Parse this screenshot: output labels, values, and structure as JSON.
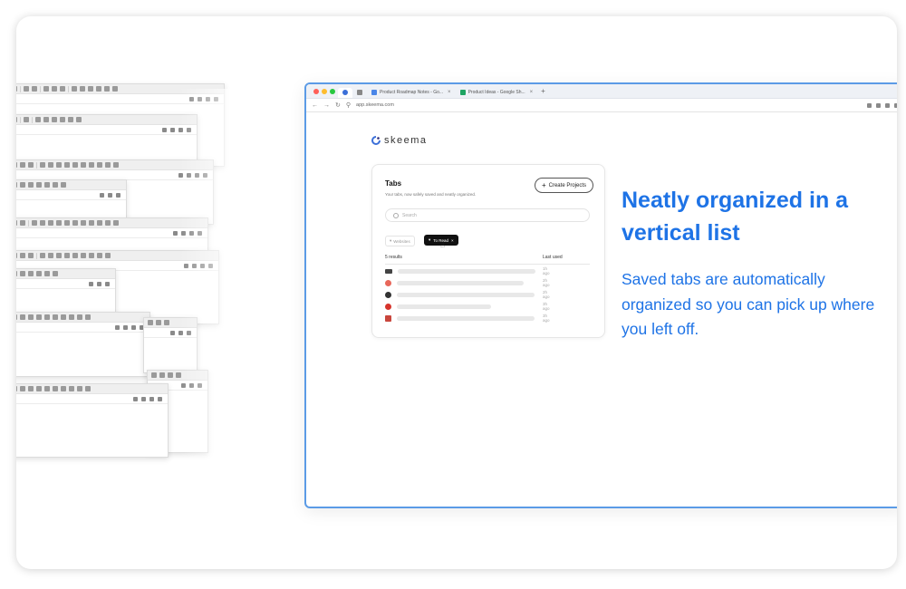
{
  "headline": "Neatly organized in a vertical list",
  "body": "Saved tabs are automatically organized so you can pick up where you left off.",
  "colors": {
    "accent": "#1e73e6",
    "window_border": "#5b9be6",
    "filter_chip": "#111111"
  },
  "browser": {
    "tabs": [
      {
        "label": "",
        "icon": "skeema-logo-icon",
        "color": "#3b6fd8"
      },
      {
        "label": "",
        "icon": "mail-icon",
        "color": "#888888"
      },
      {
        "label": "Product Roadmap Notes - Go...",
        "icon": "docs-icon",
        "color": "#4a86e8"
      },
      {
        "label": "Product Ideas - Google Sh...",
        "icon": "sheets-icon",
        "color": "#1fa463"
      }
    ],
    "url": "app.skeema.com"
  },
  "app": {
    "logo_text": "skeema",
    "panel": {
      "title": "Tabs",
      "subtitle": "Your tabs, now safely saved and neatly organized.",
      "create_button": "Create Projects",
      "search_placeholder": "Search",
      "filters": [
        {
          "label": "Websites",
          "active": false
        },
        {
          "label": "To Read",
          "active": true
        }
      ],
      "results_label": "5 results",
      "last_used_label": "Last used",
      "rows": [
        {
          "icon": "pc-icon",
          "color": "#444444",
          "time": "1h ago"
        },
        {
          "icon": "gmail-icon",
          "color": "#e8675a",
          "time": "2h ago"
        },
        {
          "icon": "github-icon",
          "color": "#333333",
          "time": "2h ago"
        },
        {
          "icon": "pinterest-icon",
          "color": "#d6342c",
          "time": "3h ago"
        },
        {
          "icon": "site-icon",
          "color": "#c9463d",
          "time": "3h ago"
        }
      ]
    }
  }
}
